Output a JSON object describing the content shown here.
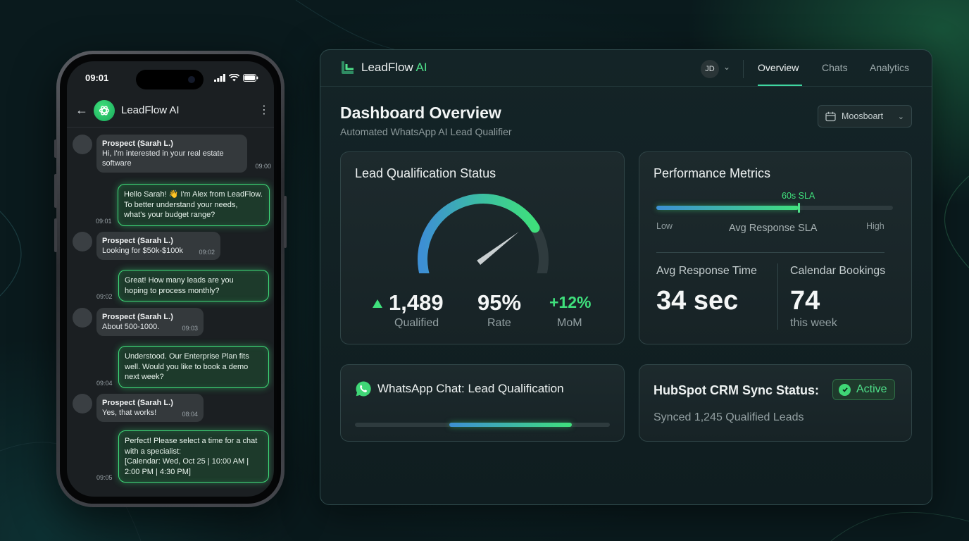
{
  "phone": {
    "status_time": "09:01",
    "chat_title": "LeadFlow AI",
    "messages": [
      {
        "dir": "in",
        "sender": "Prospect (Sarah L.)",
        "lines": [
          "Hi, I'm interested in your real estate",
          "software"
        ],
        "time": "09:00"
      },
      {
        "dir": "out",
        "lines": [
          "Hello Sarah! 👋 I'm Alex from LeadFlow.",
          "To better understand your needs,",
          "what's your budget range?"
        ],
        "time": "09:01"
      },
      {
        "dir": "in",
        "sender": "Prospect (Sarah L.)",
        "lines": [
          "Looking for $50k-$100k"
        ],
        "time": "09:02"
      },
      {
        "dir": "out",
        "lines": [
          "Great! How many leads are you",
          "hoping to process monthly?"
        ],
        "time": "09:02"
      },
      {
        "dir": "in",
        "sender": "Prospect (Sarah L.)",
        "lines": [
          "About 500-1000."
        ],
        "time": "09:03"
      },
      {
        "dir": "out",
        "lines": [
          "Understood. Our Enterprise Plan fits",
          "well. Would you like to book a demo",
          "next week?"
        ],
        "time": "09:04"
      },
      {
        "dir": "in",
        "sender": "Prospect (Sarah L.)",
        "lines": [
          "Yes, that works!"
        ],
        "time": "08:04"
      },
      {
        "dir": "out",
        "lines": [
          "Perfect! Please select a time for a chat",
          "with a specialist:",
          "[Calendar: Wed, Oct 25 | 10:00 AM |",
          "2:00 PM | 4:30 PM]"
        ],
        "time": "09:05"
      }
    ]
  },
  "dashboard": {
    "brand_name": "LeadFlow",
    "brand_suffix": "AI",
    "user_initials": "JD",
    "tabs": [
      "Overview",
      "Chats",
      "Analytics"
    ],
    "page_title": "Dashboard Overview",
    "page_subtitle": "Automated WhatsApp AI Lead Qualifier",
    "dropdown_value": "Moosboart",
    "lead_card": {
      "title": "Lead Qualification Status",
      "gauge_fraction": 0.78,
      "stats": [
        {
          "value": "1,489",
          "label": "Qualified"
        },
        {
          "value": "95%",
          "label": "Rate"
        },
        {
          "value": "+12%",
          "label": "MoM"
        }
      ]
    },
    "metrics_card": {
      "title": "Performance Metrics",
      "sla_label": "60s SLA",
      "sla_fraction": 0.6,
      "low_label": "Low",
      "high_label": "High",
      "track_caption": "Avg Response SLA",
      "response_title": "Avg Response Time",
      "response_value": "34 sec",
      "bookings_title": "Calendar Bookings",
      "bookings_value": "74",
      "bookings_unit": "this week"
    },
    "whatsapp_card": {
      "title": "WhatsApp Chat: Lead Qualification",
      "progress_start": 0.37,
      "progress_end": 0.85
    },
    "hubspot_card": {
      "title": "HubSpot CRM Sync Status:",
      "badge": "Active",
      "subtitle": "Synced 1,245 Qualified Leads"
    },
    "colors": {
      "accent_green": "#3fe07c",
      "accent_blue": "#3d8fd4"
    }
  }
}
